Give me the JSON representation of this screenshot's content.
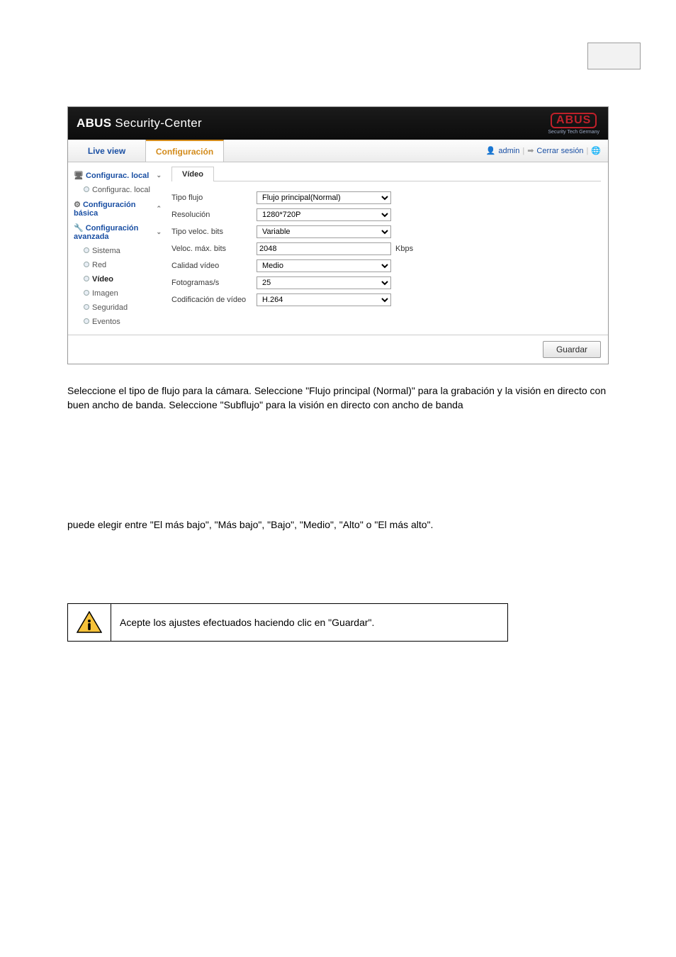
{
  "app": {
    "brand_main": "ABUS",
    "brand_rest": "Security-Center",
    "logo_text": "ABUS",
    "logo_tag": "Security Tech Germany"
  },
  "tabs": {
    "liveview": "Live view",
    "config": "Configuración"
  },
  "user": {
    "name": "admin",
    "logout": "Cerrar sesión"
  },
  "sidebar": {
    "g1": {
      "label": "Configurac. local",
      "sub": "Configurac. local"
    },
    "g2": {
      "label": "Configuración básica"
    },
    "g3": {
      "label": "Configuración avanzada",
      "items": {
        "sistema": "Sistema",
        "red": "Red",
        "video": "Vídeo",
        "imagen": "Imagen",
        "seguridad": "Seguridad",
        "eventos": "Eventos"
      }
    }
  },
  "panel": {
    "tab_label": "Vídeo",
    "rows": {
      "tipo_flujo": {
        "label": "Tipo flujo",
        "value": "Flujo principal(Normal)"
      },
      "resolucion": {
        "label": "Resolución",
        "value": "1280*720P"
      },
      "tipo_veloc": {
        "label": "Tipo veloc. bits",
        "value": "Variable"
      },
      "veloc_max": {
        "label": "Veloc. máx. bits",
        "value": "2048",
        "unit": "Kbps"
      },
      "calidad": {
        "label": "Calidad vídeo",
        "value": "Medio"
      },
      "fps": {
        "label": "Fotogramas/s",
        "value": "25"
      },
      "codec": {
        "label": "Codificación de vídeo",
        "value": "H.264"
      }
    },
    "save": "Guardar"
  },
  "paragraphs": {
    "p1": "Seleccione el tipo de flujo para la cámara. Seleccione \"Flujo principal (Normal)\" para la grabación y la visión en directo con buen ancho de banda. Seleccione \"Subflujo\" para la visión en directo con ancho de banda",
    "p2": "puede elegir entre \"El más bajo\", \"Más bajo\", \"Bajo\", \"Medio\", \"Alto\" o \"El más alto\".",
    "info": "Acepte los ajustes efectuados haciendo clic en \"Guardar\"."
  }
}
